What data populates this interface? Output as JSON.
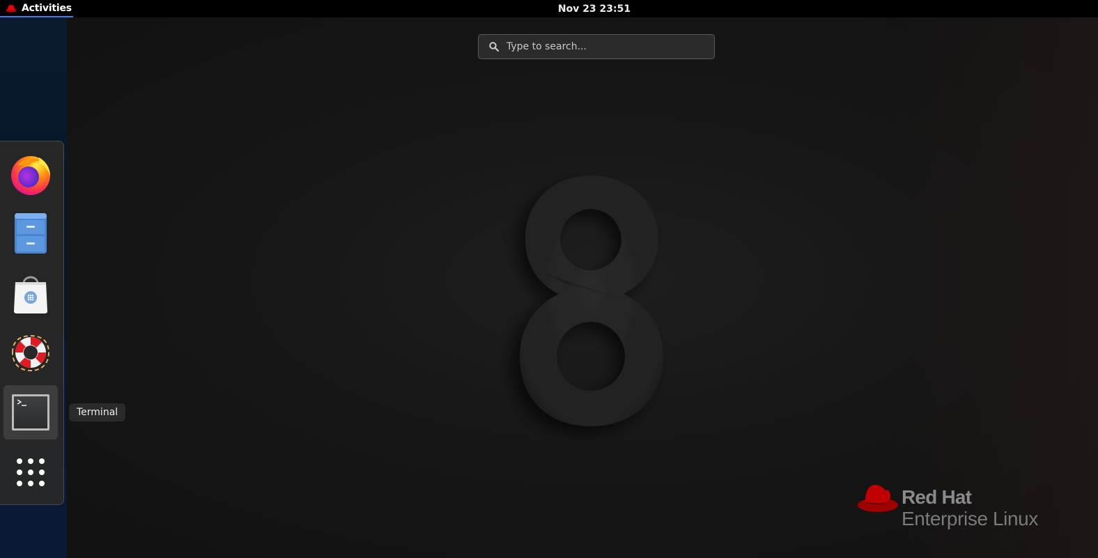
{
  "topbar": {
    "activities_label": "Activities",
    "clock": "Nov 23  23:51"
  },
  "search": {
    "placeholder": "Type to search...",
    "value": ""
  },
  "dash": {
    "items": [
      {
        "name": "Firefox",
        "icon": "firefox-icon"
      },
      {
        "name": "Files",
        "icon": "file-cabinet-icon"
      },
      {
        "name": "Software",
        "icon": "shopping-bag-icon"
      },
      {
        "name": "Help",
        "icon": "lifebuoy-icon"
      },
      {
        "name": "Terminal",
        "icon": "terminal-icon",
        "active": true
      },
      {
        "name": "Show Applications",
        "icon": "app-grid-icon"
      }
    ],
    "tooltip": "Terminal"
  },
  "wallpaper": {
    "numeral": "8",
    "brand": "Red Hat",
    "product": "Enterprise Linux"
  },
  "colors": {
    "accent": "#3584e4",
    "redhat_red": "#ee0000",
    "topbar": "#000000"
  }
}
